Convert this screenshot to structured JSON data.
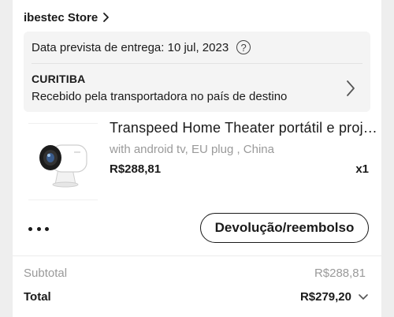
{
  "store": {
    "name": "ibestec Store",
    "chevron_icon": "chevron-right-icon"
  },
  "shipping": {
    "estimated_delivery": "Data prevista de entrega: 10 jul, 2023",
    "help_icon": "question-circle-icon",
    "help_glyph": "?",
    "location": "CURITIBA",
    "status": "Recebido pela transportadora no país de destino"
  },
  "product": {
    "title": "Transpeed Home Theater portátil e projetor",
    "variant": "with android tv, EU plug , China",
    "price": "R$288,81",
    "quantity": "x1",
    "image_icon": "projector-image"
  },
  "actions": {
    "more_icon": "more-dots-icon",
    "refund_label": "Devolução/reembolso"
  },
  "summary": {
    "subtotal_label": "Subtotal",
    "subtotal_value": "R$288,81",
    "total_label": "Total",
    "total_value": "R$279,20",
    "expand_icon": "chevron-down-icon"
  }
}
